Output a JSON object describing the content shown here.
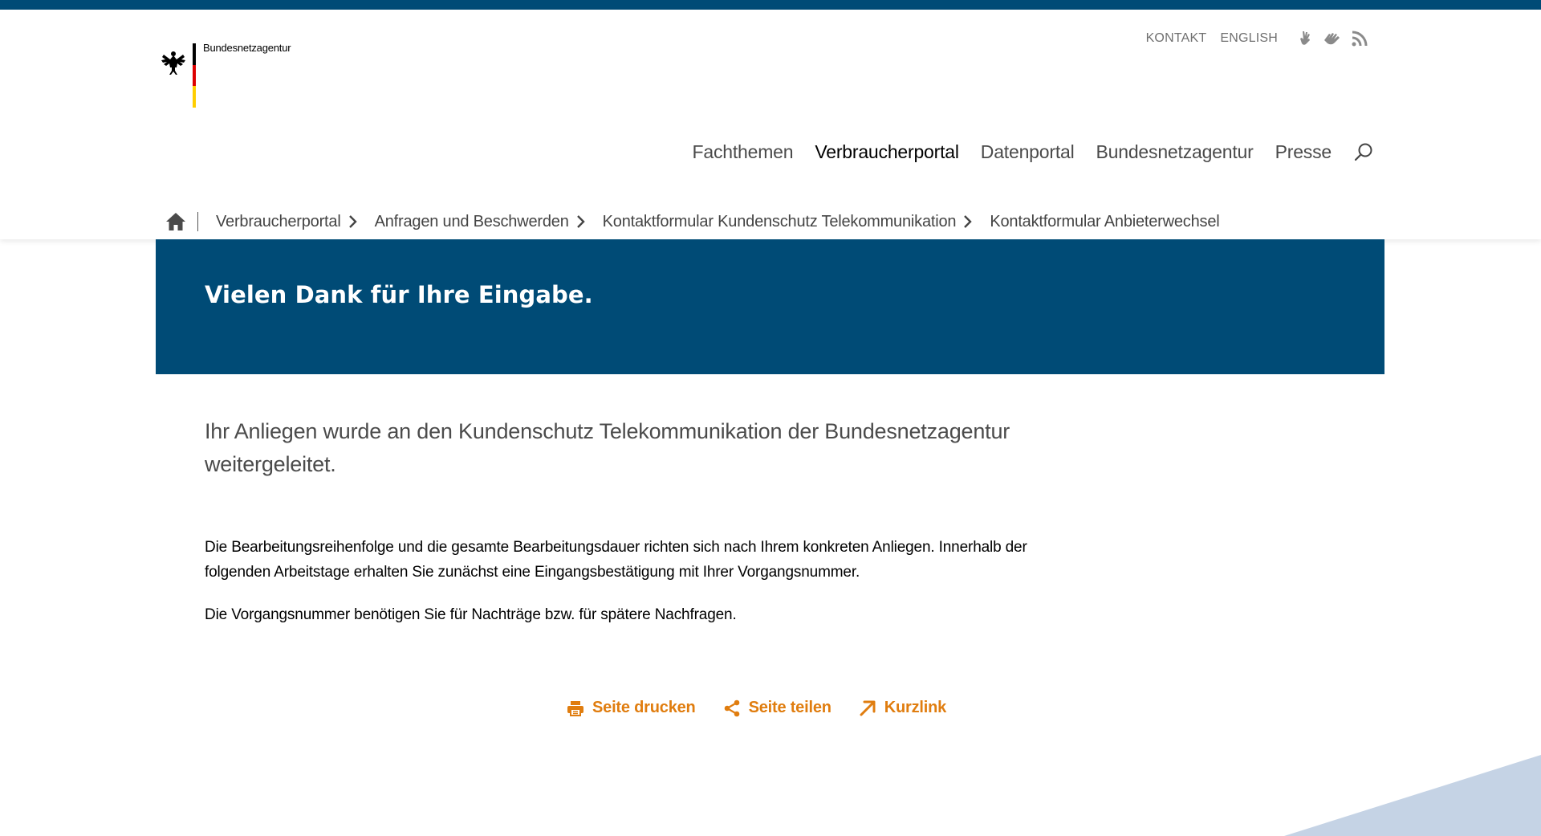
{
  "header": {
    "logo_text": "Bundesnetzagentur",
    "service_links": [
      {
        "label": "KONTAKT"
      },
      {
        "label": "ENGLISH"
      }
    ],
    "service_icons": [
      "sign-language-icon",
      "easy-language-icon",
      "rss-icon"
    ]
  },
  "mainnav": {
    "items": [
      {
        "label": "Fachthemen",
        "active": false
      },
      {
        "label": "Verbraucherportal",
        "active": true
      },
      {
        "label": "Datenportal",
        "active": false
      },
      {
        "label": "Bundesnetzagentur",
        "active": false
      },
      {
        "label": "Presse",
        "active": false
      }
    ],
    "search_icon": "search-icon"
  },
  "breadcrumb": {
    "home_icon": "home-icon",
    "items": [
      {
        "label": "Verbraucherportal"
      },
      {
        "label": "Anfragen und Beschwerden"
      },
      {
        "label": "Kontaktformular Kundenschutz Telekommunikation"
      },
      {
        "label": "Kontaktformular Anbieterwechsel"
      }
    ]
  },
  "banner": {
    "title": "Vielen Dank für Ihre Eingabe."
  },
  "content": {
    "lead": "Ihr Anliegen wurde an den Kundenschutz Telekommunikation der Bundesnetzagentur weitergeleitet.",
    "paragraph1": "Die Bearbeitungsreihenfolge und die gesamte Bearbeitungsdauer richten sich nach Ihrem konkreten Anliegen. Innerhalb der folgenden Arbeitstage erhalten Sie zunächst eine Eingangsbestätigung mit Ihrer Vorgangsnummer.",
    "paragraph2": "Die Vorgangsnummer benötigen Sie für Nachträge bzw. für spätere Nachfragen."
  },
  "actions": [
    {
      "label": "Seite drucken",
      "icon": "print-icon"
    },
    {
      "label": "Seite teilen",
      "icon": "share-icon"
    },
    {
      "label": "Kurzlink",
      "icon": "arrow-up-right-icon"
    }
  ],
  "colors": {
    "brand_blue": "#004b76",
    "action_orange": "#e07d0f",
    "flag_black": "#000000",
    "flag_red": "#dd0000",
    "flag_gold": "#ffce00",
    "deco_blue": "#c5d3e5"
  }
}
